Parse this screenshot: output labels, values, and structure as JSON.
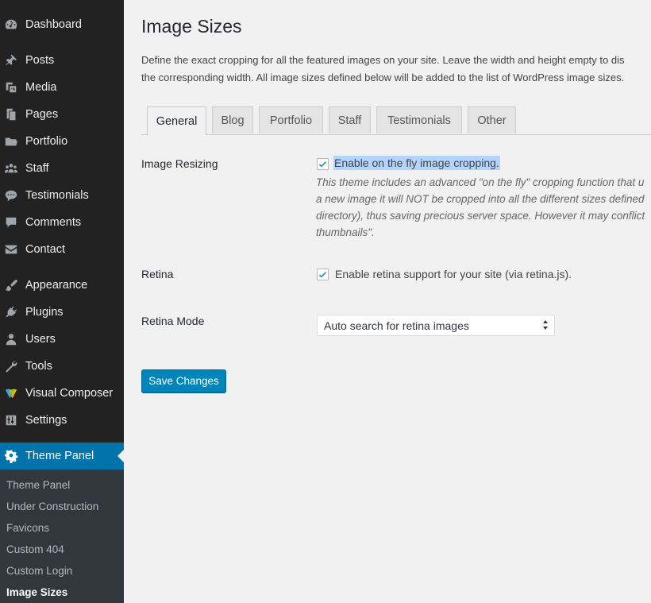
{
  "sidebar": {
    "items": [
      {
        "label": "Dashboard",
        "icon": "dashboard-icon"
      },
      {
        "label": "Posts",
        "icon": "pushpin-icon"
      },
      {
        "label": "Media",
        "icon": "media-icon"
      },
      {
        "label": "Pages",
        "icon": "pages-icon"
      },
      {
        "label": "Portfolio",
        "icon": "folder-icon"
      },
      {
        "label": "Staff",
        "icon": "staff-icon"
      },
      {
        "label": "Testimonials",
        "icon": "speech-bubble-icon"
      },
      {
        "label": "Comments",
        "icon": "comment-icon"
      },
      {
        "label": "Contact",
        "icon": "envelope-icon"
      },
      {
        "label": "Appearance",
        "icon": "paintbrush-icon"
      },
      {
        "label": "Plugins",
        "icon": "plug-icon"
      },
      {
        "label": "Users",
        "icon": "user-icon"
      },
      {
        "label": "Tools",
        "icon": "wrench-icon"
      },
      {
        "label": "Visual Composer",
        "icon": "visual-composer-icon"
      },
      {
        "label": "Settings",
        "icon": "settings-icon"
      },
      {
        "label": "Theme Panel",
        "icon": "gear-icon"
      }
    ],
    "submenu": [
      "Theme Panel",
      "Under Construction",
      "Favicons",
      "Custom 404",
      "Custom Login",
      "Image Sizes"
    ],
    "active_color": "#0073aa"
  },
  "page": {
    "title": "Image Sizes",
    "description_line1": "Define the exact cropping for all the featured images on your site. Leave the width and height empty to dis",
    "description_line2": "the corresponding width. All image sizes defined below will be added to the list of WordPress image sizes."
  },
  "tabs": [
    "General",
    "Blog",
    "Portfolio",
    "Staff",
    "Testimonials",
    "Other"
  ],
  "settings": {
    "resizing_label": "Image Resizing",
    "resizing_checkbox": "Enable on the fly image cropping.",
    "resizing_desc1": "This theme includes an advanced \"on the fly\" cropping function that u",
    "resizing_desc2": "a new image it will NOT be cropped into all the different sizes defined",
    "resizing_desc3": "directory), thus saving precious server space. However it may conflict",
    "resizing_desc4": "thumbnails\".",
    "retina_label": "Retina",
    "retina_checkbox": "Enable retina support for your site (via retina.js).",
    "retina_mode_label": "Retina Mode",
    "retina_mode_value": "Auto search for retina images"
  },
  "save_button": "Save Changes"
}
